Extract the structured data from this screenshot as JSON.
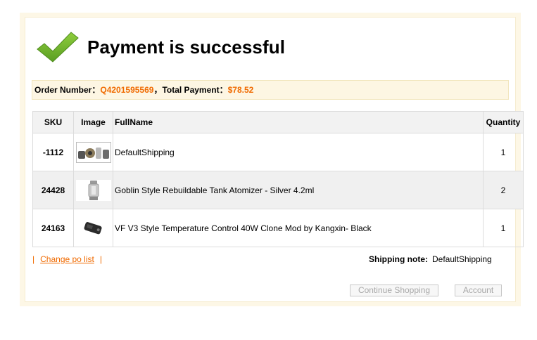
{
  "header": {
    "title": "Payment is successful"
  },
  "order": {
    "number_label": "Order Number：",
    "number_value": "Q4201595569",
    "separator": "，",
    "total_label": "Total Payment：",
    "total_value": "$78.52"
  },
  "table": {
    "columns": [
      "SKU",
      "Image",
      "FullName",
      "Quantity"
    ],
    "rows": [
      {
        "sku": "-1112",
        "name": "DefaultShipping",
        "quantity": "1",
        "image_icon": "shipping-thumbnail-icon"
      },
      {
        "sku": "24428",
        "name": "Goblin Style Rebuildable Tank Atomizer - Silver 4.2ml",
        "quantity": "2",
        "image_icon": "atomizer-thumbnail-icon"
      },
      {
        "sku": "24163",
        "name": "VF V3 Style Temperature Control 40W Clone Mod by Kangxin- Black",
        "quantity": "1",
        "image_icon": "mod-thumbnail-icon"
      }
    ]
  },
  "links": {
    "bar_left": "|",
    "change_po_list": "Change po list",
    "bar_right": "|"
  },
  "shipping_note": {
    "label": "Shipping note:",
    "value": "DefaultShipping"
  },
  "buttons": {
    "continue_shopping": "Continue Shopping",
    "account": "Account"
  },
  "colors": {
    "accent": "#f06a00",
    "check_green": "#6cae2c",
    "order_bar_bg": "#fdf6e3"
  }
}
